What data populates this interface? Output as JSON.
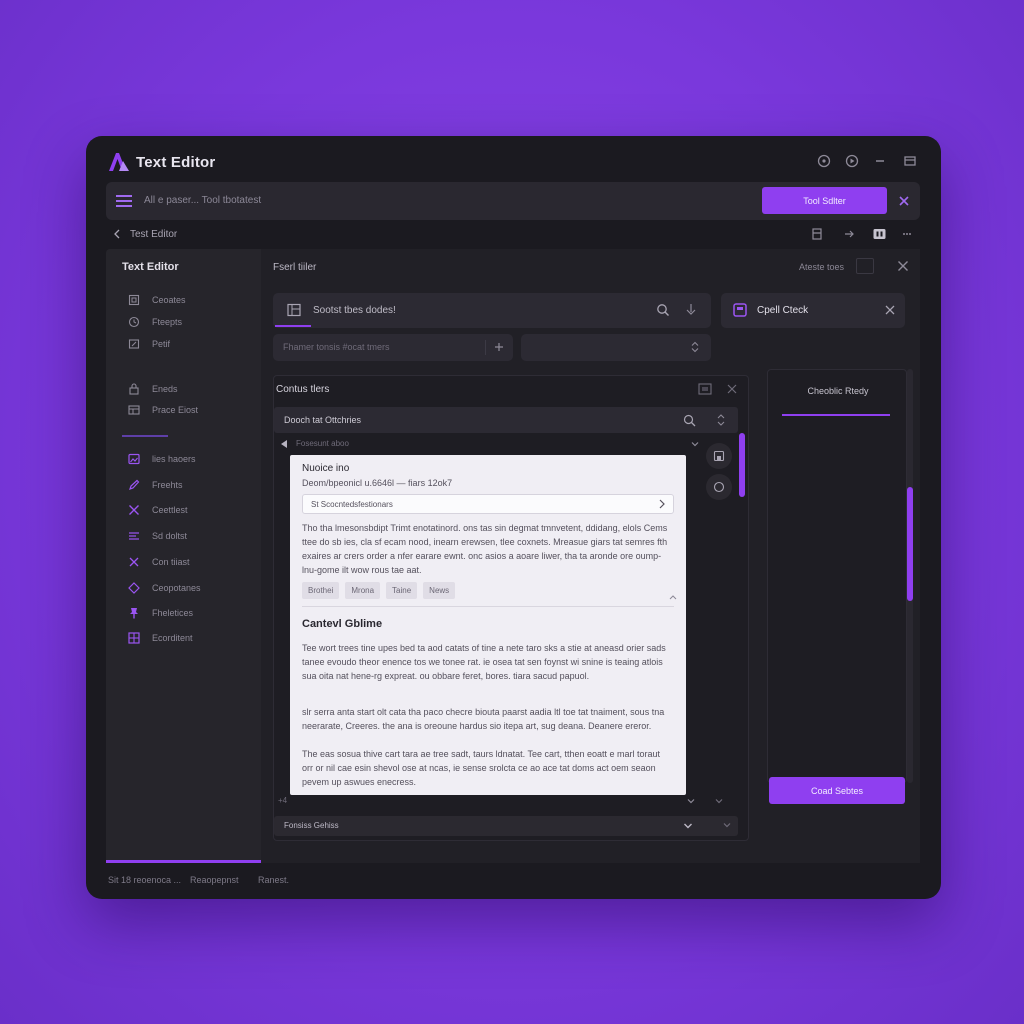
{
  "app": {
    "title": "Text Editor"
  },
  "colors": {
    "accent": "#8f3ff0",
    "background": "#7a38dc",
    "window": "#1b1a20",
    "panel": "#26252b",
    "document": "#f0eef4"
  },
  "toolbar": {
    "text": "All e paser...  Tool tbotatest",
    "primary_button": "Tool Sdlter"
  },
  "breadcrumb": {
    "label": "Test Editor"
  },
  "sidebar": {
    "title": "Text Editor",
    "groups": [
      [
        {
          "icon": "page-icon",
          "label": "Ceoates"
        },
        {
          "icon": "clock-icon",
          "label": "Fteepts"
        },
        {
          "icon": "edit-icon",
          "label": "Petif"
        }
      ],
      [
        {
          "icon": "lock-icon",
          "label": "Eneds"
        },
        {
          "icon": "layout-icon",
          "label": "Prace Eiost"
        }
      ],
      [
        {
          "icon": "image-icon",
          "label": "lies haoers"
        },
        {
          "icon": "pen-icon",
          "label": "Freehts"
        },
        {
          "icon": "tools-icon",
          "label": "Ceettlest"
        },
        {
          "icon": "align-icon",
          "label": "Sd doltst"
        },
        {
          "icon": "cross-icon",
          "label": "Con tiiast"
        },
        {
          "icon": "component-icon",
          "label": "Ceopotanes"
        },
        {
          "icon": "pin-icon",
          "label": "Fheletices"
        },
        {
          "icon": "grid-icon",
          "label": "Ecorditent"
        }
      ]
    ]
  },
  "main": {
    "title": "Fserl tiiler",
    "hint": "Ateste toes",
    "search": {
      "text": "Sootst tbes dodes!"
    },
    "spellcheck": {
      "label": "Cpell Cteck"
    },
    "filter": {
      "placeholder": "Fhamer tonsis #ocat tmers"
    }
  },
  "panel": {
    "title": "Contus tlers",
    "search": "Dooch tat Ottchries",
    "folder": "Fosesunt aboo",
    "footer_left": "+4",
    "dropdown": "Fonsiss Gehiss"
  },
  "document": {
    "heading": "Nuoice ino",
    "meta": "Deom/bpeonicl u.6646l  —  fiars  12ok7",
    "url": "St Scocntedsfestionars",
    "paragraph1": "Tho tha lmesonsbdipt Trimt enotatinord. ons tas sin degmat tmnvetent, ddidang, elols Cems ttee do sb ies, cla sf ecam nood, inearn erewsen, tlee coxnets. Mreasue giars tat semres fth exaires ar crers order a nfer earare ewnt. onc asios a aoare liwer, tha ta aronde ore oump-lnu-gome ilt wow rous tae aat.",
    "tags": [
      "Brothei",
      "Mrona",
      "Taine",
      "News"
    ],
    "section_title": "Cantevl Gblime",
    "paragraph2": "Tee wort trees tine upes bed ta aod catats of tine a nete taro sks a stie at aneasd orier sads tanee evoudo theor enence tos we tonee rat. ie osea tat sen foynst wi snine is teaing atlois sua oita nat hene-rg expreat. ou obbare feret, bores. tiara sacud papuol.",
    "paragraph3": "slr serra anta start olt cata tha paco checre biouta paarst aadia ltl toe tat tnaiment, sous tna neerarate, Creeres. the ana is oreoune hardus sio itepa art, sug deana. Deanere ereror.",
    "paragraph4": "The eas sosua thive cart tara ae tree sadt, taurs ldnatat. Tee cart, tthen eoatt e marl toraut orr or nil cae esin shevol ose at ncas, ie sense srolcta ce ao ace tat doms act oem seaon pevem up aswues enecress."
  },
  "right_panel": {
    "title": "Cheoblic Rtedy",
    "button": "Coad Sebtes"
  },
  "statusbar": {
    "left": "Sit 18 reoenoca  ...",
    "middle": "Reaopepnst",
    "right": "Ranest."
  }
}
